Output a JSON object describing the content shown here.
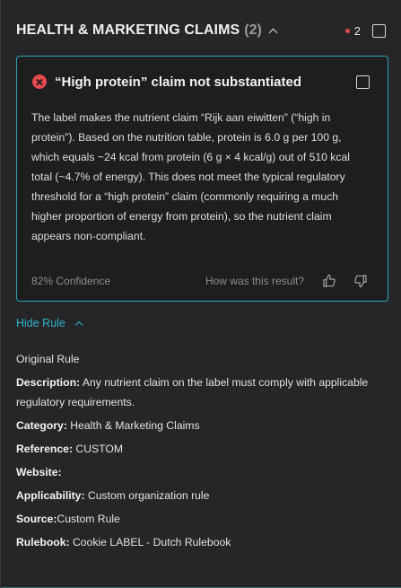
{
  "header": {
    "title": "HEALTH & MARKETING CLAIMS",
    "count": "(2)",
    "issue_count": "2"
  },
  "card": {
    "title": "“High protein” claim not substantiated",
    "body": "The label makes the nutrient claim “Rijk aan eiwitten” (“high in protein”). Based on the nutrition table, protein is 6.0 g per 100 g, which equals ~24 kcal from protein (6 g × 4 kcal/g) out of 510 kcal total (~4.7% of energy). This does not meet the typical regulatory threshold for a “high protein” claim (commonly requiring a much higher proportion of energy from protein), so the nutrient claim appears non-compliant.",
    "confidence": "82% Confidence",
    "feedback_question": "How was this result?"
  },
  "rule_toggle": {
    "label": "Hide Rule"
  },
  "rule": {
    "heading": "Original Rule",
    "rows": [
      {
        "label": "Description:",
        "value": " Any nutrient claim on the label must comply with applicable regulatory requirements."
      },
      {
        "label": "Category:",
        "value": " Health & Marketing Claims"
      },
      {
        "label": "Reference:",
        "value": " CUSTOM"
      },
      {
        "label": "Website:",
        "value": ""
      },
      {
        "label": "Applicability:",
        "value": " Custom organization rule"
      },
      {
        "label": "Source:",
        "value": "Custom Rule"
      },
      {
        "label": "Rulebook:",
        "value": " Cookie LABEL - Dutch Rulebook"
      }
    ]
  },
  "icons": {
    "collapse": "chevron-up-icon",
    "status": "error-x-icon",
    "like": "thumbs-up-icon",
    "dislike": "thumbs-down-icon"
  },
  "colors": {
    "accent": "#2fb2c6",
    "error": "#e5484d",
    "background": "#262628"
  }
}
